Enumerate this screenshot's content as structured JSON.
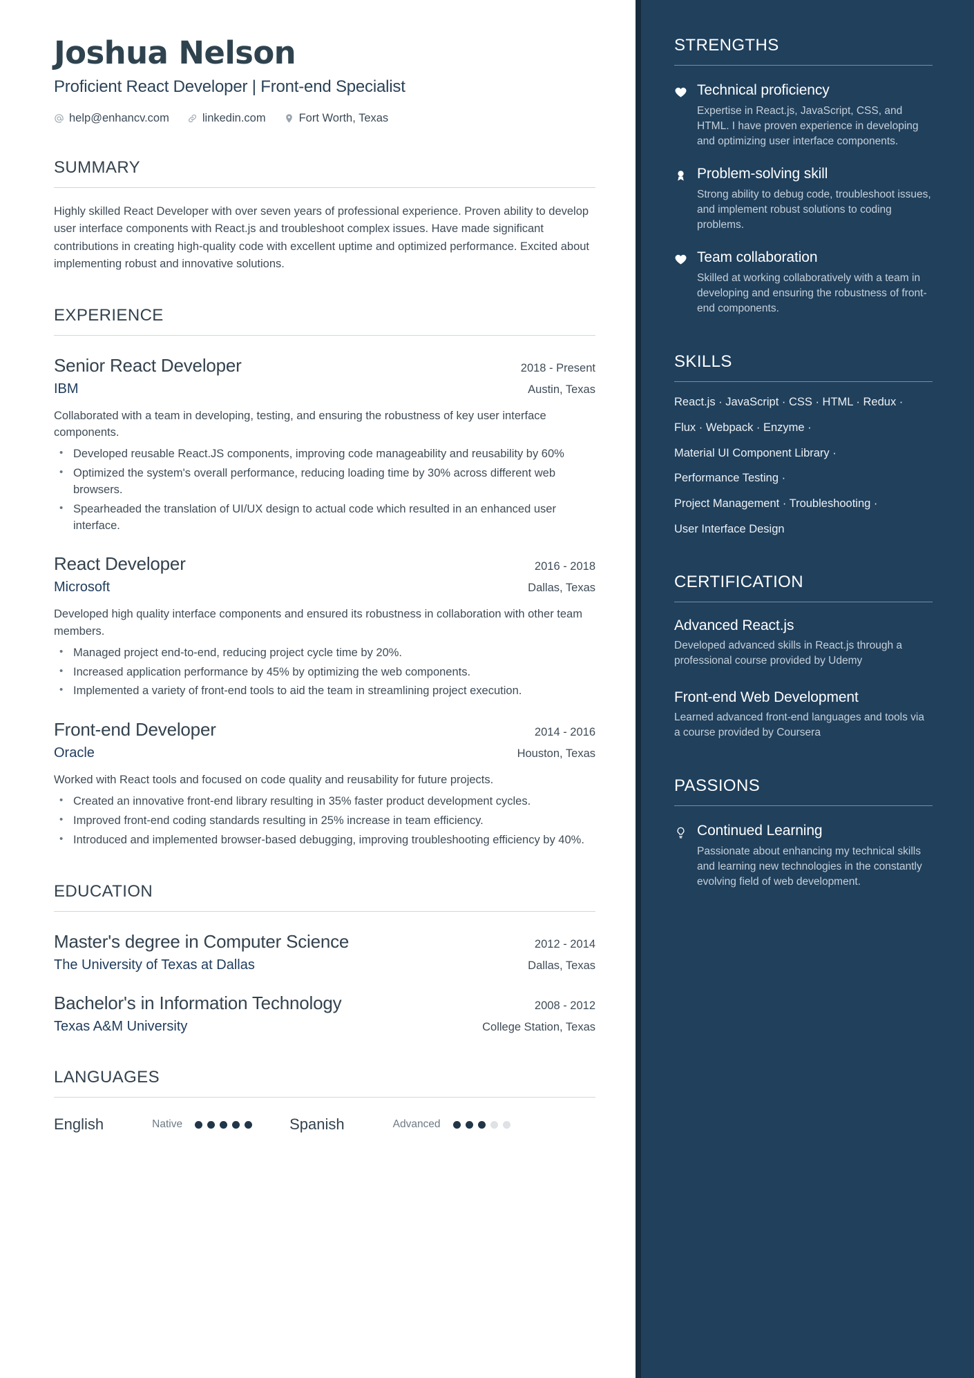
{
  "colors": {
    "sidebar_bg": "#20405c",
    "sidebar_accent": "#172b3c",
    "heading": "#33424e",
    "link": "#1f3b5c",
    "body": "#3f4c57"
  },
  "header": {
    "name": "Joshua Nelson",
    "headline": "Proficient React Developer | Front-end Specialist",
    "contacts": [
      {
        "icon": "at-icon",
        "text": "help@enhancv.com"
      },
      {
        "icon": "link-icon",
        "text": "linkedin.com"
      },
      {
        "icon": "location-pin-icon",
        "text": "Fort Worth, Texas"
      }
    ]
  },
  "summary": {
    "title": "SUMMARY",
    "text": "Highly skilled React Developer with over seven years of professional experience. Proven ability to develop user interface components with React.js and troubleshoot complex issues. Have made significant contributions in creating high-quality code with excellent uptime and optimized performance. Excited about implementing robust and innovative solutions."
  },
  "experience": {
    "title": "EXPERIENCE",
    "entries": [
      {
        "title": "Senior React Developer",
        "date": "2018 - Present",
        "org": "IBM",
        "location": "Austin, Texas",
        "desc": "Collaborated with a team in developing, testing, and ensuring the robustness of key user interface components.",
        "bullets": [
          "Developed reusable React.JS components, improving code manageability and reusability by 60%",
          "Optimized the system's overall performance, reducing loading time by 30% across different web browsers.",
          "Spearheaded the translation of UI/UX design to actual code which resulted in an enhanced user interface."
        ]
      },
      {
        "title": "React Developer",
        "date": "2016 - 2018",
        "org": "Microsoft",
        "location": "Dallas, Texas",
        "desc": "Developed high quality interface components and ensured its robustness in collaboration with other team members.",
        "bullets": [
          "Managed project end-to-end, reducing project cycle time by 20%.",
          "Increased application performance by 45% by optimizing the web components.",
          "Implemented a variety of front-end tools to aid the team in streamlining project execution."
        ]
      },
      {
        "title": "Front-end Developer",
        "date": "2014 - 2016",
        "org": "Oracle",
        "location": "Houston, Texas",
        "desc": "Worked with React tools and focused on code quality and reusability for future projects.",
        "bullets": [
          "Created an innovative front-end library resulting in 35% faster product development cycles.",
          "Improved front-end coding standards resulting in 25% increase in team efficiency.",
          "Introduced and implemented browser-based debugging, improving troubleshooting efficiency by 40%."
        ]
      }
    ]
  },
  "education": {
    "title": "EDUCATION",
    "entries": [
      {
        "title": "Master's degree in Computer Science",
        "date": "2012 - 2014",
        "org": "The University of Texas at Dallas",
        "location": "Dallas, Texas"
      },
      {
        "title": "Bachelor's in Information Technology",
        "date": "2008 - 2012",
        "org": "Texas A&M University",
        "location": "College Station, Texas"
      }
    ]
  },
  "languages": {
    "title": "LANGUAGES",
    "items": [
      {
        "name": "English",
        "level": "Native",
        "filled": 5,
        "total": 5
      },
      {
        "name": "Spanish",
        "level": "Advanced",
        "filled": 3,
        "total": 5
      }
    ]
  },
  "strengths": {
    "title": "STRENGTHS",
    "items": [
      {
        "icon": "heart-icon",
        "name": "Technical proficiency",
        "desc": "Expertise in React.js, JavaScript, CSS, and HTML. I have proven experience in developing and optimizing user interface components."
      },
      {
        "icon": "award-ribbon-icon",
        "name": "Problem-solving skill",
        "desc": "Strong ability to debug code, troubleshoot issues, and implement robust solutions to coding problems."
      },
      {
        "icon": "heart-icon",
        "name": "Team collaboration",
        "desc": "Skilled at working collaboratively with a team in developing and ensuring the robustness of front-end components."
      }
    ]
  },
  "skills": {
    "title": "SKILLS",
    "lines": [
      "React.js · JavaScript · CSS · HTML · Redux ·",
      "Flux · Webpack · Enzyme ·",
      "Material UI Component Library ·",
      "Performance Testing ·",
      "Project Management · Troubleshooting ·",
      "User Interface Design"
    ]
  },
  "certification": {
    "title": "CERTIFICATION",
    "items": [
      {
        "name": "Advanced React.js",
        "desc": "Developed advanced skills in React.js through a professional course provided by Udemy"
      },
      {
        "name": "Front-end Web Development",
        "desc": "Learned advanced front-end languages and tools via a course provided by Coursera"
      }
    ]
  },
  "passions": {
    "title": "PASSIONS",
    "items": [
      {
        "icon": "lightbulb-icon",
        "name": "Continued Learning",
        "desc": "Passionate about enhancing my technical skills and learning new technologies in the constantly evolving field of web development."
      }
    ]
  }
}
